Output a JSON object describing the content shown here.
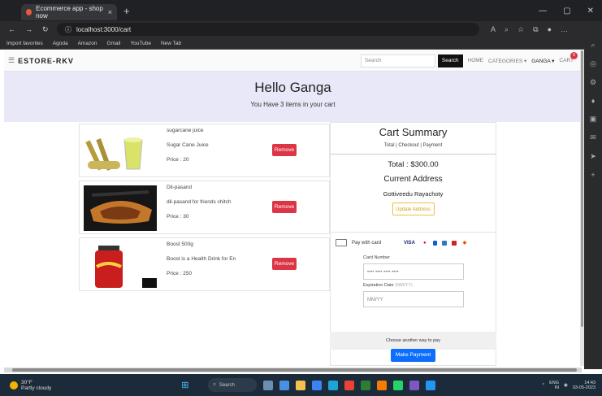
{
  "browser": {
    "tab_title": "Ecommerce app - shop now",
    "tab_close": "×",
    "new_tab": "+",
    "url": "localhost:3000/cart",
    "favorites": [
      "Import favorites",
      "Agoda",
      "Amazon",
      "Gmail",
      "YouTube",
      "New Tab"
    ]
  },
  "navbar": {
    "brand": "ESTORE-RKV",
    "search_placeholder": "Search",
    "search_button": "Search",
    "home": "HOME",
    "categories": "CATEGORIES ▾",
    "user": "GANGA ▾",
    "cart": "CART",
    "cart_count": "0"
  },
  "hero": {
    "greeting": "Hello Ganga",
    "subtitle": "You Have 3 items in your cart"
  },
  "items": [
    {
      "name": "sugarcane juice",
      "desc": "Sugar Cane Juice",
      "price": "Price : 20",
      "remove": "Remove"
    },
    {
      "name": "Dil-pasand",
      "desc": "dil-pasand for friends chitch",
      "price": "Price : 30",
      "remove": "Remove"
    },
    {
      "name": "Boost 500g",
      "desc": "Boost is a Health Drink for En",
      "price": "Price : 250",
      "remove": "Remove"
    }
  ],
  "summary": {
    "title": "Cart Summary",
    "subtitle": "Total | Checkout | Payment",
    "total": "Total : $300.00",
    "address_title": "Current Address",
    "address": "Gottiveedu Rayachoty",
    "update": "Update Address"
  },
  "payment": {
    "pay_with": "Pay with card",
    "card_label": "Card Number",
    "card_placeholder": "•••• •••• •••• ••••",
    "exp_label": "Expiration Date",
    "exp_hint": "(MM/YY)",
    "exp_placeholder": "MM/YY",
    "choose": "Choose another way to pay",
    "make_payment": "Make Payment"
  },
  "taskbar": {
    "temp": "30°F",
    "weather": "Partly cloudy",
    "search": "Search",
    "lang": "ENG",
    "region": "IN",
    "time": "14:43",
    "date": "03-05-2023"
  }
}
